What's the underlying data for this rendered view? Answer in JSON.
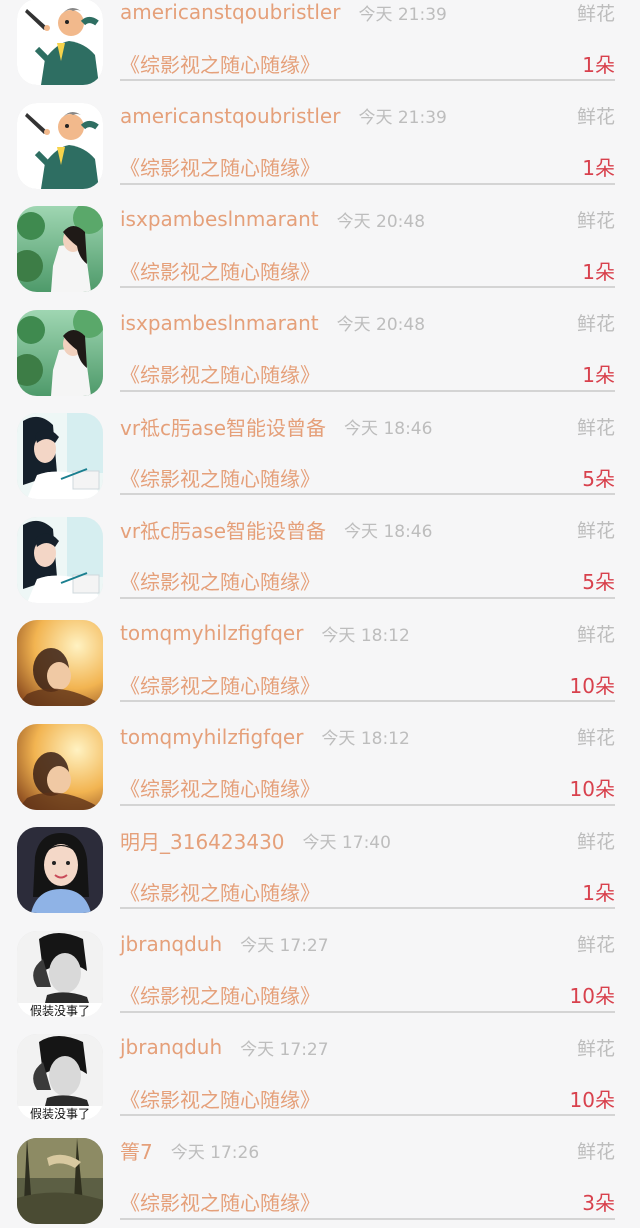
{
  "records": [
    {
      "username": "americanstqoubristler",
      "time": "今天 21:39",
      "gift_type": "鲜花",
      "work": "《综影视之随心随缘》",
      "count": "1朵",
      "avatar": "cartoon"
    },
    {
      "username": "americanstqoubristler",
      "time": "今天 21:39",
      "gift_type": "鲜花",
      "work": "《综影视之随心随缘》",
      "count": "1朵",
      "avatar": "cartoon"
    },
    {
      "username": "isxpambeslnmarant",
      "time": "今天 20:48",
      "gift_type": "鲜花",
      "work": "《综影视之随心随缘》",
      "count": "1朵",
      "avatar": "woman-trees"
    },
    {
      "username": "isxpambeslnmarant",
      "time": "今天 20:48",
      "gift_type": "鲜花",
      "work": "《综影视之随心随缘》",
      "count": "1朵",
      "avatar": "woman-trees"
    },
    {
      "username": "vr祗c肟ase智能设曾备",
      "time": "今天 18:46",
      "gift_type": "鲜花",
      "work": "《综影视之随心随缘》",
      "count": "5朵",
      "avatar": "girl-writing"
    },
    {
      "username": "vr祗c肟ase智能设曾备",
      "time": "今天 18:46",
      "gift_type": "鲜花",
      "work": "《综影视之随心随缘》",
      "count": "5朵",
      "avatar": "girl-writing"
    },
    {
      "username": "tomqmyhilzfigfqer",
      "time": "今天 18:12",
      "gift_type": "鲜花",
      "work": "《综影视之随心随缘》",
      "count": "10朵",
      "avatar": "warm-light"
    },
    {
      "username": "tomqmyhilzfigfqer",
      "time": "今天 18:12",
      "gift_type": "鲜花",
      "work": "《综影视之随心随缘》",
      "count": "10朵",
      "avatar": "warm-light"
    },
    {
      "username": "明月_316423430",
      "time": "今天 17:40",
      "gift_type": "鲜花",
      "work": "《综影视之随心随缘》",
      "count": "1朵",
      "avatar": "portrait"
    },
    {
      "username": "jbranqduh",
      "time": "今天 17:27",
      "gift_type": "鲜花",
      "work": "《综影视之随心随缘》",
      "count": "10朵",
      "avatar": "bw-man",
      "avatar_caption": "假装没事了"
    },
    {
      "username": "jbranqduh",
      "time": "今天 17:27",
      "gift_type": "鲜花",
      "work": "《综影视之随心随缘》",
      "count": "10朵",
      "avatar": "bw-man",
      "avatar_caption": "假装没事了"
    },
    {
      "username": "箐7",
      "time": "今天 17:26",
      "gift_type": "鲜花",
      "work": "《综影视之随心随缘》",
      "count": "3朵",
      "avatar": "forest"
    }
  ]
}
